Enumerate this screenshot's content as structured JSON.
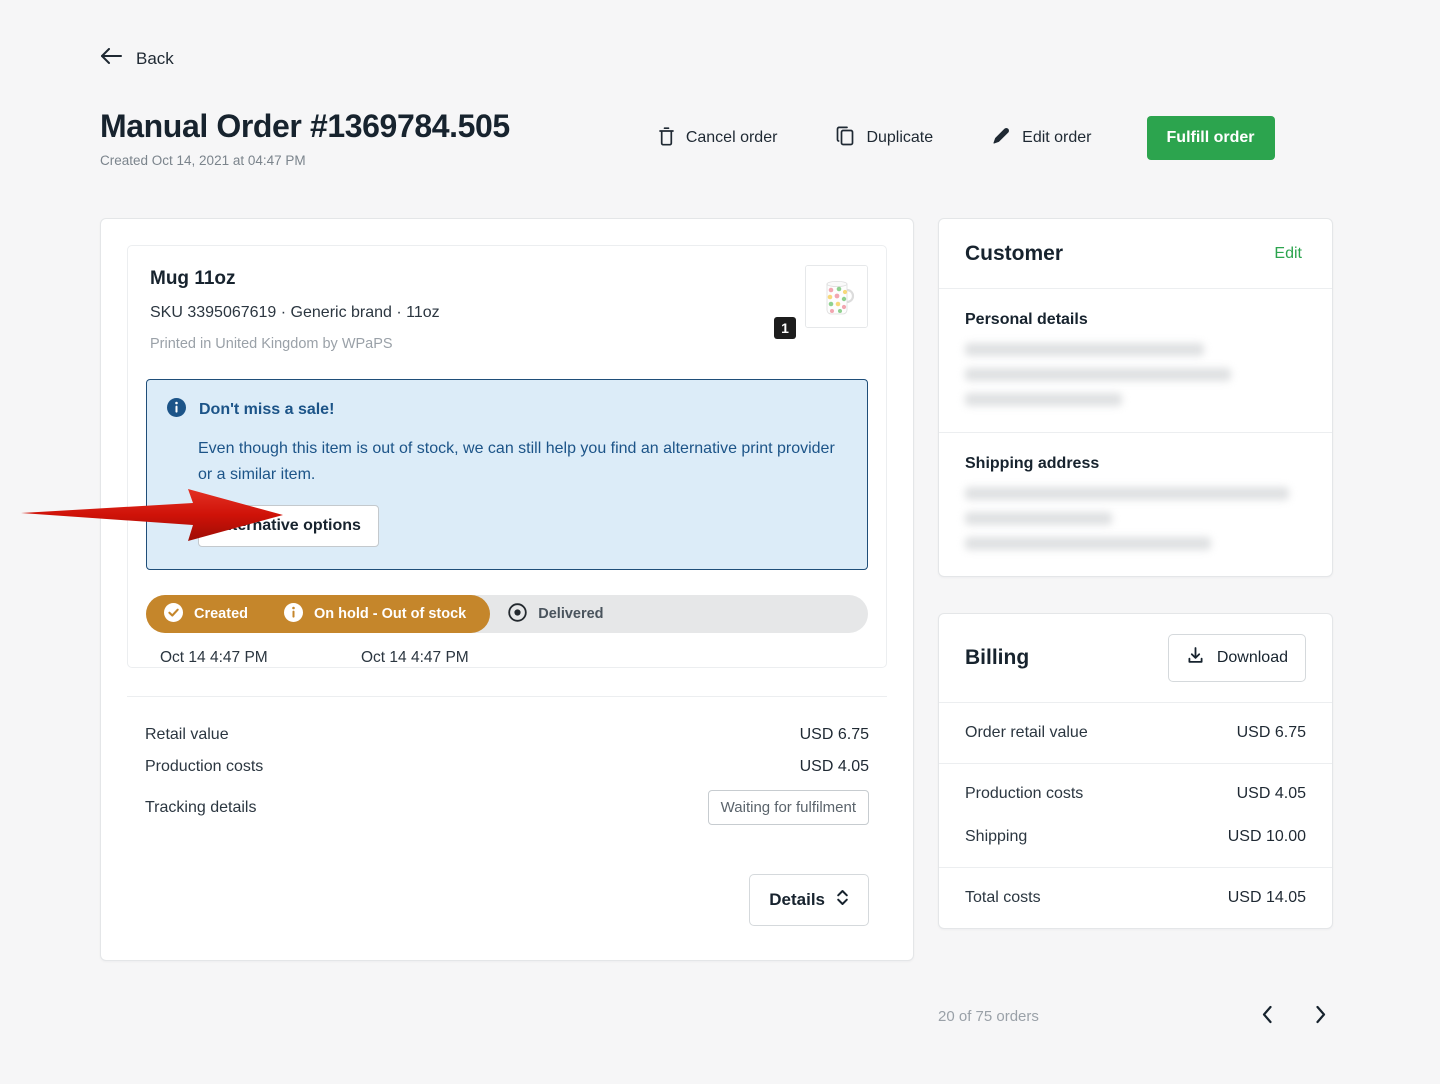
{
  "nav": {
    "back_label": "Back",
    "back_icon": "arrow-left-icon"
  },
  "header": {
    "title": "Manual Order #1369784.505",
    "created": "Created Oct 14, 2021 at 04:47 PM",
    "actions": [
      {
        "label": "Cancel order",
        "icon": "trash-icon"
      },
      {
        "label": "Duplicate",
        "icon": "copy-icon"
      },
      {
        "label": "Edit order",
        "icon": "pencil-icon"
      }
    ],
    "primary_action": {
      "label": "Fulfill order",
      "color": "#2ca44e"
    }
  },
  "item": {
    "title": "Mug 11oz",
    "meta": "SKU 3395067619  · Generic brand · 11oz",
    "printed_by": "Printed in United Kingdom by WPaPS",
    "quantity": "1",
    "thumbnail_icon": "mug-polka-dot-image"
  },
  "banner": {
    "icon": "info-circle-icon",
    "title": "Don't miss a sale!",
    "body": "Even though this item is out of stock, we can still help you find an alternative print provider or a similar item.",
    "button_label": "Alternative options",
    "bg_color": "#dcecf8",
    "border_color": "#1f4e79",
    "text_color": "#1c5488"
  },
  "tracker": {
    "active_color": "#c5862b",
    "pending_color": "#e6e7e8",
    "steps": [
      {
        "label": "Created",
        "icon": "check-circle-icon",
        "state": "done",
        "date": "Oct 14 4:47 PM"
      },
      {
        "label": "On hold - Out of stock",
        "icon": "info-circle-icon",
        "state": "current",
        "date": "Oct 14 4:47 PM"
      },
      {
        "label": "Delivered",
        "icon": "target-dot-icon",
        "state": "pending",
        "date": ""
      }
    ]
  },
  "totals": {
    "rows": [
      {
        "label": "Retail value",
        "value": "USD 6.75",
        "type": "text"
      },
      {
        "label": "Production costs",
        "value": "USD 4.05",
        "type": "text"
      },
      {
        "label": "Tracking details",
        "value": "Waiting for fulfilment",
        "type": "pill"
      }
    ],
    "details_label": "Details",
    "details_icon": "chevron-updown-icon"
  },
  "customer": {
    "title": "Customer",
    "edit_label": "Edit",
    "sections": [
      {
        "label": "Personal details",
        "redacted_widths": [
          "70%",
          "78%",
          "46%"
        ]
      },
      {
        "label": "Shipping address",
        "redacted_widths": [
          "95%",
          "43%",
          "72%"
        ]
      }
    ]
  },
  "billing": {
    "title": "Billing",
    "download_label": "Download",
    "download_icon": "download-icon",
    "rows": [
      {
        "label": "Order retail value",
        "value": "USD 6.75",
        "separator": true
      },
      {
        "label": "Production costs",
        "value": "USD 4.05",
        "separator": true
      },
      {
        "label": "Shipping",
        "value": "USD 10.00",
        "separator": false
      },
      {
        "label": "Total costs",
        "value": "USD 14.05",
        "separator": true
      }
    ]
  },
  "pager": {
    "text": "20 of 75 orders",
    "prev_icon": "chevron-left-icon",
    "next_icon": "chevron-right-icon"
  },
  "annotation": {
    "arrow_color": "#d81f12",
    "arrow_icon": "red-arrow-right"
  }
}
